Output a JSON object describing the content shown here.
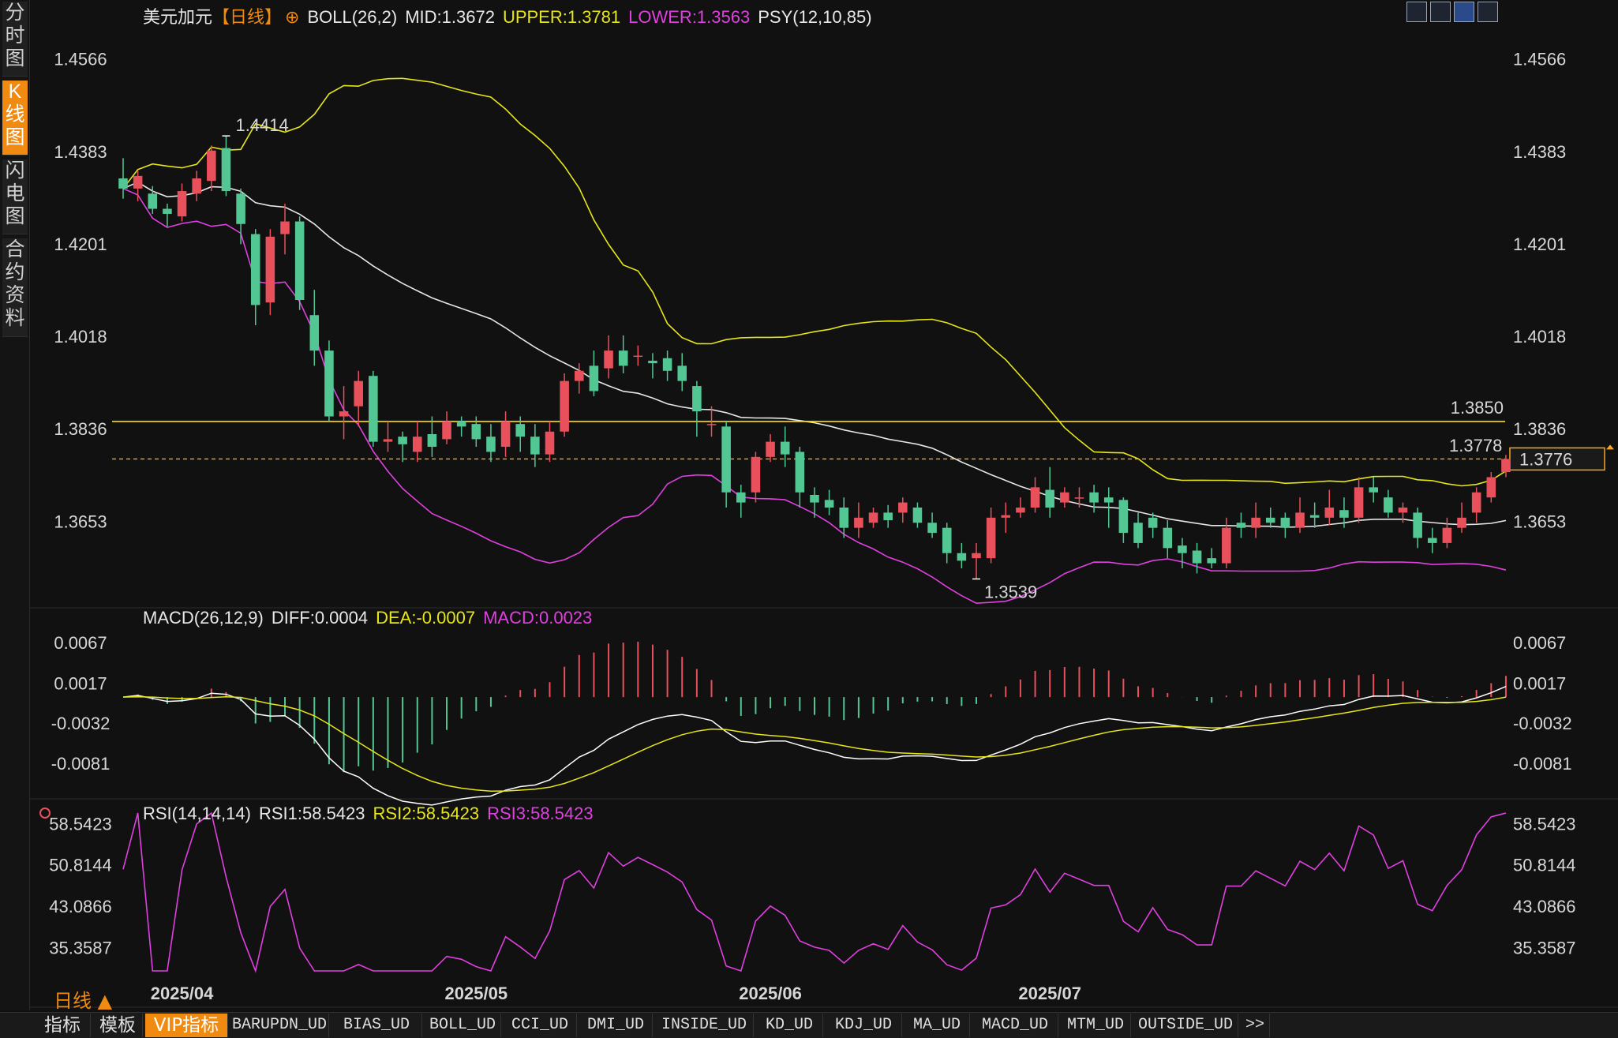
{
  "sidebar": {
    "tabs": [
      {
        "label": "分\n时\n图",
        "active": false
      },
      {
        "label": "K\n线\n图",
        "active": true
      },
      {
        "label": "闪\n电\n图",
        "active": false
      },
      {
        "label": "合\n约\n资\n料",
        "active": false
      }
    ]
  },
  "header": {
    "symbol": "美元加元",
    "period": "【日线】",
    "add_icon": "⊕",
    "boll": "BOLL(26,2)",
    "mid": "MID:1.3672",
    "upper": "UPPER:1.3781",
    "lower": "LOWER:1.3563",
    "psy": "PSY(12,10,85)"
  },
  "macd_header": {
    "name": "MACD(26,12,9)",
    "diff": "DIFF:0.0004",
    "dea": "DEA:-0.0007",
    "macd": "MACD:0.0023"
  },
  "rsi_header": {
    "name": "RSI(14,14,14)",
    "rsi1": "RSI1:58.5423",
    "rsi2": "RSI2:58.5423",
    "rsi3": "RSI3:58.5423"
  },
  "timeframe_label": "日线 ▲",
  "bottom_tabs": [
    "指标",
    "模板",
    "VIP指标",
    "BARUPDN_UD",
    "BIAS_UD",
    "BOLL_UD",
    "CCI_UD",
    "DMI_UD",
    "INSIDE_UD",
    "KD_UD",
    "KDJ_UD",
    "MA_UD",
    "MACD_UD",
    "MTM_UD",
    "OUTSIDE_UD",
    ">>"
  ],
  "colors": {
    "up": "#e8505b",
    "down": "#52c794",
    "boll_band": "#e6e619",
    "boll_lower": "#e040e0",
    "mid": "#e6e6e6",
    "level": "#ffe000",
    "last": "#f5a623"
  },
  "chart_data": {
    "type": "candlestick",
    "price_axis_ticks": [
      "1.4566",
      "1.4383",
      "1.4201",
      "1.4018",
      "1.3836",
      "1.3653"
    ],
    "price_ylim": [
      1.3521,
      1.462
    ],
    "date_labels": [
      {
        "label": "2025/04",
        "index": 4
      },
      {
        "label": "2025/05",
        "index": 24
      },
      {
        "label": "2025/06",
        "index": 44
      },
      {
        "label": "2025/07",
        "index": 63
      }
    ],
    "candles": [
      [
        1.433,
        1.431,
        1.437,
        1.429
      ],
      [
        1.431,
        1.4335,
        1.4345,
        1.4285
      ],
      [
        1.43,
        1.427,
        1.4315,
        1.426
      ],
      [
        1.427,
        1.426,
        1.428,
        1.4235
      ],
      [
        1.4255,
        1.4305,
        1.432,
        1.4245
      ],
      [
        1.43,
        1.433,
        1.4345,
        1.4285
      ],
      [
        1.4325,
        1.4385,
        1.4395,
        1.4305
      ],
      [
        1.439,
        1.4305,
        1.4414,
        1.4295
      ],
      [
        1.43,
        1.424,
        1.431,
        1.42
      ],
      [
        1.422,
        1.408,
        1.423,
        1.404
      ],
      [
        1.4085,
        1.4215,
        1.423,
        1.406
      ],
      [
        1.422,
        1.4245,
        1.428,
        1.418
      ],
      [
        1.4245,
        1.409,
        1.4255,
        1.407
      ],
      [
        1.406,
        1.399,
        1.411,
        1.396
      ],
      [
        1.399,
        1.386,
        1.401,
        1.385
      ],
      [
        1.386,
        1.387,
        1.392,
        1.3815
      ],
      [
        1.388,
        1.393,
        1.395,
        1.384
      ],
      [
        1.394,
        1.381,
        1.395,
        1.38
      ],
      [
        1.381,
        1.3815,
        1.385,
        1.379
      ],
      [
        1.382,
        1.3805,
        1.383,
        1.377
      ],
      [
        1.379,
        1.382,
        1.385,
        1.377
      ],
      [
        1.3825,
        1.38,
        1.386,
        1.378
      ],
      [
        1.3815,
        1.385,
        1.387,
        1.3805
      ],
      [
        1.385,
        1.384,
        1.386,
        1.382
      ],
      [
        1.3845,
        1.3815,
        1.386,
        1.38
      ],
      [
        1.382,
        1.379,
        1.3845,
        1.377
      ],
      [
        1.38,
        1.385,
        1.387,
        1.378
      ],
      [
        1.3845,
        1.382,
        1.386,
        1.379
      ],
      [
        1.382,
        1.3785,
        1.3845,
        1.376
      ],
      [
        1.3785,
        1.383,
        1.385,
        1.377
      ],
      [
        1.383,
        1.393,
        1.3945,
        1.382
      ],
      [
        1.393,
        1.395,
        1.3965,
        1.3905
      ],
      [
        1.396,
        1.391,
        1.399,
        1.39
      ],
      [
        1.3955,
        1.399,
        1.402,
        1.3935
      ],
      [
        1.399,
        1.396,
        1.402,
        1.3945
      ],
      [
        1.398,
        1.398,
        1.4,
        1.396
      ],
      [
        1.397,
        1.3965,
        1.3985,
        1.3935
      ],
      [
        1.3975,
        1.395,
        1.399,
        1.393
      ],
      [
        1.396,
        1.393,
        1.3985,
        1.391
      ],
      [
        1.392,
        1.387,
        1.393,
        1.382
      ],
      [
        1.3845,
        1.3845,
        1.388,
        1.382
      ],
      [
        1.384,
        1.371,
        1.385,
        1.368
      ],
      [
        1.371,
        1.369,
        1.3725,
        1.366
      ],
      [
        1.371,
        1.378,
        1.379,
        1.369
      ],
      [
        1.378,
        1.381,
        1.3825,
        1.377
      ],
      [
        1.381,
        1.3785,
        1.384,
        1.376
      ],
      [
        1.379,
        1.371,
        1.38,
        1.368
      ],
      [
        1.3705,
        1.369,
        1.372,
        1.366
      ],
      [
        1.3695,
        1.368,
        1.3715,
        1.3665
      ],
      [
        1.368,
        1.364,
        1.37,
        1.362
      ],
      [
        1.364,
        1.366,
        1.369,
        1.362
      ],
      [
        1.365,
        1.367,
        1.368,
        1.364
      ],
      [
        1.367,
        1.3655,
        1.3685,
        1.364
      ],
      [
        1.367,
        1.369,
        1.37,
        1.365
      ],
      [
        1.368,
        1.365,
        1.369,
        1.364
      ],
      [
        1.365,
        1.363,
        1.367,
        1.362
      ],
      [
        1.364,
        1.359,
        1.365,
        1.357
      ],
      [
        1.359,
        1.3575,
        1.361,
        1.356
      ],
      [
        1.358,
        1.359,
        1.361,
        1.3539
      ],
      [
        1.358,
        1.366,
        1.368,
        1.357
      ],
      [
        1.366,
        1.3665,
        1.369,
        1.363
      ],
      [
        1.367,
        1.368,
        1.37,
        1.366
      ],
      [
        1.368,
        1.372,
        1.374,
        1.367
      ],
      [
        1.3715,
        1.368,
        1.376,
        1.366
      ],
      [
        1.369,
        1.371,
        1.372,
        1.368
      ],
      [
        1.37,
        1.37,
        1.372,
        1.368
      ],
      [
        1.371,
        1.369,
        1.3725,
        1.367
      ],
      [
        1.37,
        1.369,
        1.372,
        1.364
      ],
      [
        1.3695,
        1.363,
        1.37,
        1.361
      ],
      [
        1.365,
        1.361,
        1.367,
        1.36
      ],
      [
        1.366,
        1.364,
        1.367,
        1.362
      ],
      [
        1.364,
        1.36,
        1.3655,
        1.358
      ],
      [
        1.3605,
        1.359,
        1.362,
        1.356
      ],
      [
        1.3595,
        1.357,
        1.361,
        1.355
      ],
      [
        1.358,
        1.357,
        1.36,
        1.356
      ],
      [
        1.357,
        1.364,
        1.366,
        1.356
      ],
      [
        1.365,
        1.364,
        1.367,
        1.362
      ],
      [
        1.364,
        1.366,
        1.369,
        1.362
      ],
      [
        1.366,
        1.365,
        1.368,
        1.364
      ],
      [
        1.366,
        1.364,
        1.367,
        1.362
      ],
      [
        1.364,
        1.367,
        1.37,
        1.363
      ],
      [
        1.3665,
        1.366,
        1.369,
        1.364
      ],
      [
        1.366,
        1.368,
        1.3715,
        1.3645
      ],
      [
        1.3675,
        1.366,
        1.37,
        1.364
      ],
      [
        1.366,
        1.372,
        1.374,
        1.365
      ],
      [
        1.372,
        1.371,
        1.374,
        1.369
      ],
      [
        1.37,
        1.367,
        1.3715,
        1.366
      ],
      [
        1.367,
        1.368,
        1.369,
        1.365
      ],
      [
        1.367,
        1.362,
        1.368,
        1.36
      ],
      [
        1.362,
        1.361,
        1.364,
        1.359
      ],
      [
        1.361,
        1.364,
        1.366,
        1.36
      ],
      [
        1.364,
        1.366,
        1.369,
        1.363
      ],
      [
        1.367,
        1.371,
        1.372,
        1.365
      ],
      [
        1.37,
        1.374,
        1.375,
        1.369
      ],
      [
        1.375,
        1.3776,
        1.3784,
        1.374
      ]
    ],
    "horizontal_line": {
      "value": 1.385,
      "label": "1.3850"
    },
    "last_price": {
      "value": 1.3776,
      "label": "1.3776"
    },
    "high_marker": {
      "value": 1.4414,
      "label": "1.4414",
      "index": 7
    },
    "low_marker": {
      "value": 1.3539,
      "label": "1.3539",
      "index": 58
    },
    "recent_high": {
      "value": 1.3778,
      "label": "1.3778"
    },
    "macd_axis_ticks": [
      "0.0067",
      "0.0017",
      "-0.0032",
      "-0.0081"
    ],
    "macd_ylim": [
      -0.0113,
      0.009
    ],
    "rsi_axis_ticks": [
      "58.5423",
      "50.8144",
      "43.0866",
      "35.3587"
    ],
    "rsi_ylim": [
      31.0,
      60.5
    ]
  }
}
